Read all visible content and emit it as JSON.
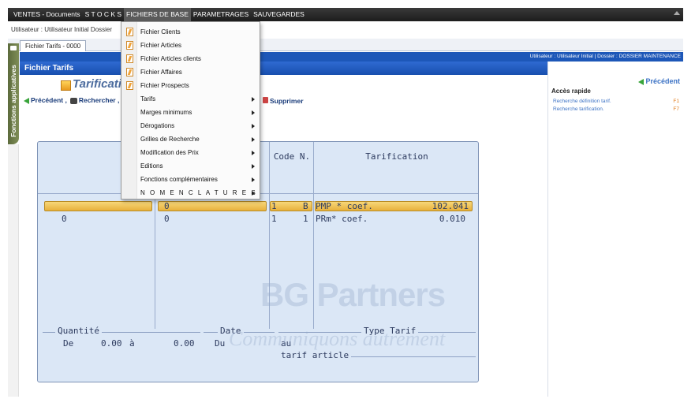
{
  "menubar": {
    "items": [
      "VENTES - Documents",
      "S T O C K S",
      "FICHIERS DE BASE",
      "PARAMETRAGES",
      "SAUVEGARDES"
    ]
  },
  "userbar": {
    "text": "Utilisateur : Utilisateur Initial  Dossier"
  },
  "tab": {
    "label": "Fichier Tarifs - 0000"
  },
  "sidebar": {
    "vertical_label": "Fonctions applicatives"
  },
  "header": {
    "bluebar_text": "Utilisateur : Utilisateur Initial | Dossier : DOSSIER MAINTENANCE",
    "pane_title": "Fichier Tarifs",
    "page_title": "Tarificati"
  },
  "toolbar": {
    "precedent": "Précédent ,",
    "rechercher": "Rechercher ,",
    "supprimer": "Supprimer"
  },
  "dropdown": {
    "items": [
      {
        "label": "Fichier Clients",
        "icon": "document-icon"
      },
      {
        "label": "Fichier Articles",
        "icon": "document-icon"
      },
      {
        "label": "Fichier Articles clients",
        "icon": "document-icon"
      },
      {
        "label": "Fichier Affaires",
        "icon": "document-icon"
      },
      {
        "label": "Fichier Prospects",
        "icon": "document-icon"
      },
      {
        "label": "Tarifs",
        "submenu": true
      },
      {
        "label": "Marges minimums",
        "submenu": true
      },
      {
        "label": "Dérogations",
        "submenu": true
      },
      {
        "label": "Grilles de Recherche",
        "submenu": true
      },
      {
        "label": "Modification des Prix",
        "submenu": true
      },
      {
        "label": "Editions",
        "submenu": true
      },
      {
        "label": "Fonctions complémentaires",
        "submenu": true
      },
      {
        "label": "N O M E N C L A T U R E S",
        "submenu": true
      }
    ]
  },
  "grid": {
    "headers": [
      "Code N.",
      "Tarification"
    ],
    "rows": [
      {
        "c1": "",
        "c2": "0",
        "c3a": "1",
        "c3b": "B",
        "c4a": "PMP * coef.",
        "c4b": "102.041"
      },
      {
        "c1": "0",
        "c2": "0",
        "c3a": "1",
        "c3b": "1",
        "c4a": "PRm* coef.",
        "c4b": "0.010"
      }
    ],
    "footer": {
      "quantite_label": "Quantité",
      "date_label": "Date",
      "type_label": "Type Tarif",
      "de": "De",
      "qty_from": "0.00",
      "a": "à",
      "qty_to": "0.00",
      "du": "Du",
      "au": "au",
      "type_value": "tarif article"
    }
  },
  "watermark": {
    "text": "BG Partners",
    "tagline": "Communiquons autrement"
  },
  "rightpane": {
    "precedent": "Précédent",
    "acces_rapide": "Accès rapide",
    "links": [
      {
        "label": "Recherche définition tarif.",
        "key": "F1"
      },
      {
        "label": "Recherche tarification.",
        "key": "F7"
      }
    ]
  },
  "colors": {
    "menubar": "#1c1c1c",
    "accent_blue": "#1d57b8",
    "highlight": "#e8b13c",
    "grid_bg": "#dbe7f6"
  }
}
